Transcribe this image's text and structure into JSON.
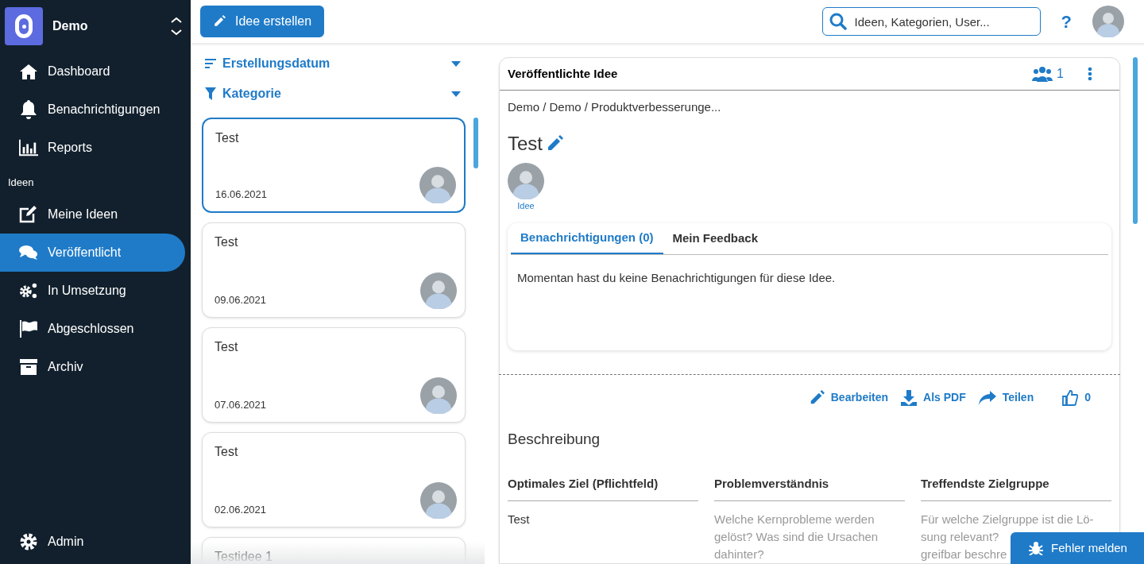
{
  "workspace": {
    "name": "Demo"
  },
  "nav": {
    "top": [
      {
        "label": "Dashboard",
        "selected": false
      },
      {
        "label": "Benachrichtigungen",
        "selected": false
      },
      {
        "label": "Reports",
        "selected": false
      }
    ],
    "section_label": "Ideen",
    "items": [
      {
        "label": "Meine Ideen",
        "selected": false
      },
      {
        "label": "Veröffentlicht",
        "selected": true
      },
      {
        "label": "In Umsetzung",
        "selected": false
      },
      {
        "label": "Abgeschlossen",
        "selected": false
      },
      {
        "label": "Archiv",
        "selected": false
      }
    ],
    "bottom": {
      "label": "Admin"
    }
  },
  "topbar": {
    "create_button": "Idee erstellen",
    "search": {
      "placeholder": "Ideen, Kategorien, User..."
    },
    "help": "?"
  },
  "filters": [
    "Erstellungsdatum",
    "Kategorie"
  ],
  "ideas": [
    {
      "title": "Test",
      "date": "16.06.2021",
      "selected": true
    },
    {
      "title": "Test",
      "date": "09.06.2021",
      "selected": false
    },
    {
      "title": "Test",
      "date": "07.06.2021",
      "selected": false
    },
    {
      "title": "Test",
      "date": "02.06.2021",
      "selected": false
    },
    {
      "title": "Testidee 1",
      "selected": false
    }
  ],
  "detail": {
    "header": "Veröffentlichte Idee",
    "members": "1",
    "breadcrumb": "Demo / Demo / Produktverbesserunge...",
    "title": "Test",
    "author_label": "Idee",
    "tabs": [
      {
        "label": "Benachrichtigungen (0)",
        "selected": true
      },
      {
        "label": "Mein Feedback",
        "selected": false
      }
    ],
    "tab_message": "Momentan hast du keine Benachrichtigungen für diese Idee.",
    "actions": [
      "Bearbeiten",
      "Als PDF",
      "Teilen"
    ],
    "likes": "0",
    "section": "Beschreibung",
    "columns": [
      {
        "heading": "Optimales Ziel (Pflichtfeld)",
        "kind": "value",
        "lines": [
          "Test"
        ]
      },
      {
        "heading": "Problemverständnis",
        "kind": "hint",
        "lines": [
          "Welche Kernprobleme werden",
          "gelöst? Was sind die Ursachen",
          "dahinter?"
        ]
      },
      {
        "heading": "Treffendste Zielgruppe",
        "kind": "hint",
        "lines": [
          "Für welche Zielgruppe ist die Lö-",
          "sung relevant?",
          "greifbar beschre"
        ]
      }
    ]
  },
  "report_button": "Fehler melden"
}
